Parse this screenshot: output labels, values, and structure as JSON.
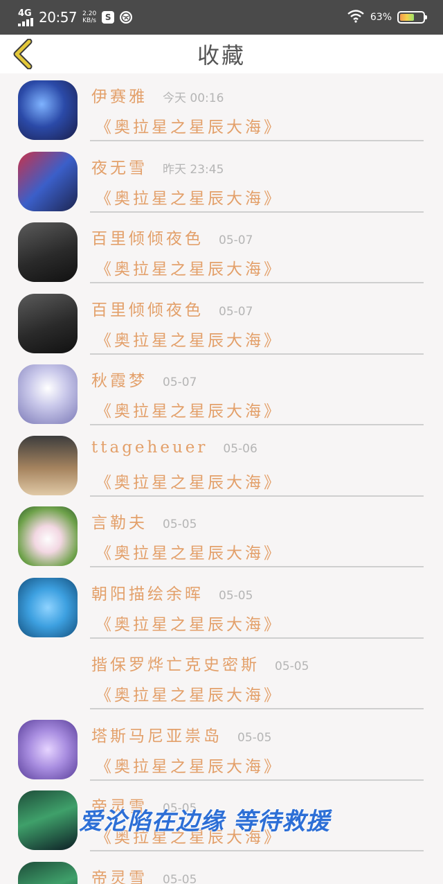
{
  "status_bar": {
    "network": "4G",
    "time": "20:57",
    "speed_value": "2.20",
    "speed_unit": "KB/s",
    "battery_percent": "63%",
    "battery_level": 0.63,
    "icons": [
      "signal-icon",
      "app-s-icon",
      "app-globe-icon",
      "wifi-icon",
      "battery-icon"
    ]
  },
  "header": {
    "title": "收藏",
    "back_icon": "chevron-left-icon"
  },
  "favorites": [
    {
      "name": "伊赛雅",
      "time": "今天 00:16",
      "book": "《奥拉星之星辰大海》"
    },
    {
      "name": "夜无雪",
      "time": "昨天 23:45",
      "book": "《奥拉星之星辰大海》"
    },
    {
      "name": "百里倾倾夜色",
      "time": "05-07",
      "book": "《奥拉星之星辰大海》"
    },
    {
      "name": "百里倾倾夜色",
      "time": "05-07",
      "book": "《奥拉星之星辰大海》"
    },
    {
      "name": "秋霞梦",
      "time": "05-07",
      "book": "《奥拉星之星辰大海》"
    },
    {
      "name": "ttageheuer",
      "time": "05-06",
      "book": "《奥拉星之星辰大海》"
    },
    {
      "name": "言勒夫",
      "time": "05-05",
      "book": "《奥拉星之星辰大海》"
    },
    {
      "name": "朝阳描绘余晖",
      "time": "05-05",
      "book": "《奥拉星之星辰大海》"
    },
    {
      "name": "揩保罗烨亡克史密斯",
      "time": "05-05",
      "book": "《奥拉星之星辰大海》"
    },
    {
      "name": "塔斯马尼亚祟岛",
      "time": "05-05",
      "book": "《奥拉星之星辰大海》"
    },
    {
      "name": "帝灵雪",
      "time": "05-05",
      "book": "《奥拉星之星辰大海》"
    },
    {
      "name": "帝灵雪",
      "time": "05-05",
      "book": ""
    }
  ],
  "overlay": {
    "text": "爱沦陷在边缘 等待救援"
  },
  "colors": {
    "status_bg": "#4a4a4a",
    "accent_text": "#e3a06a",
    "time_text": "#b5b5b5",
    "overlay_text": "#2d6fd6",
    "back_chevron": "#e3c83a"
  }
}
